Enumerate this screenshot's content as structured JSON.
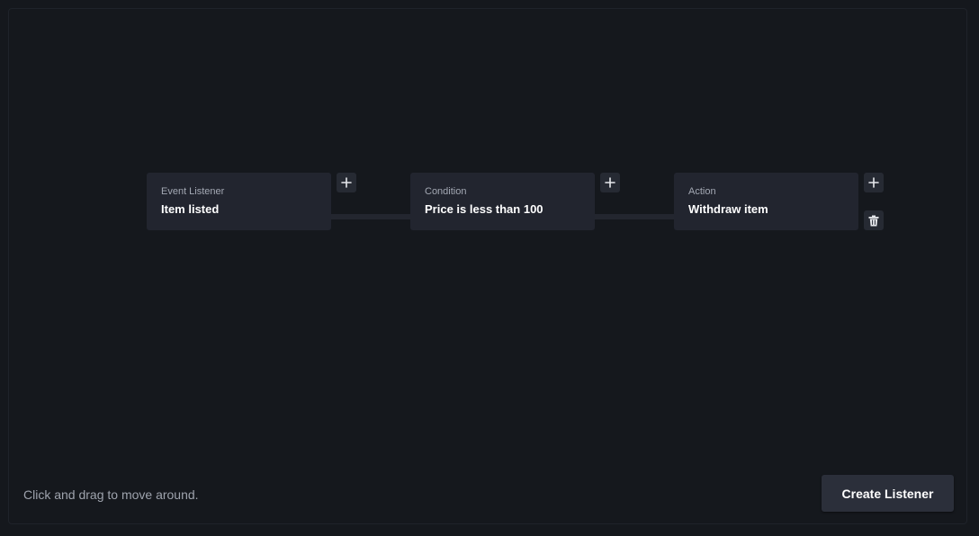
{
  "canvas": {
    "hint": "Click and drag to move around."
  },
  "nodes": [
    {
      "type": "Event Listener",
      "value": "Item listed"
    },
    {
      "type": "Condition",
      "value": "Price is less than 100"
    },
    {
      "type": "Action",
      "value": "Withdraw item"
    }
  ],
  "icons": {
    "add": "plus-icon",
    "delete": "trash-icon"
  },
  "footer": {
    "create_label": "Create Listener"
  },
  "colors": {
    "background": "#15181d",
    "node": "#22252f",
    "button": "#2b2f3a",
    "text_primary": "#ffffff",
    "text_muted": "#9ea3ad"
  }
}
